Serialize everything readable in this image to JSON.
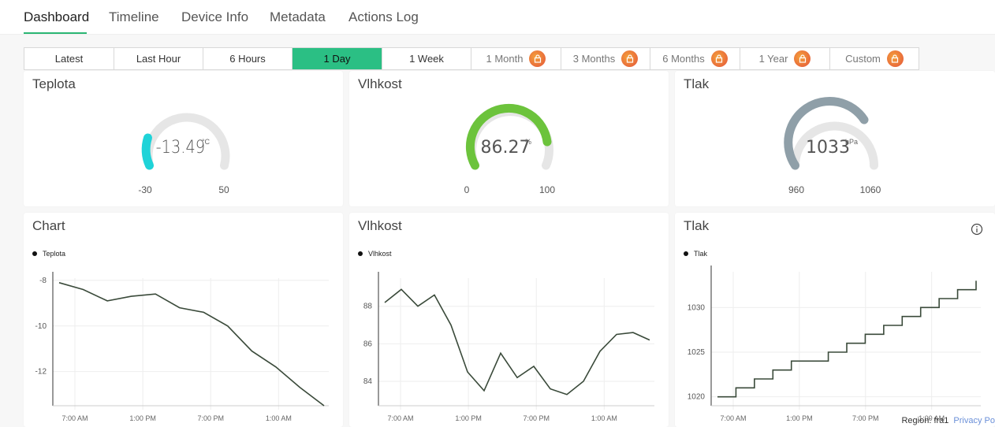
{
  "tabs": [
    {
      "label": "Dashboard",
      "active": true
    },
    {
      "label": "Timeline"
    },
    {
      "label": "Device Info"
    },
    {
      "label": "Metadata"
    },
    {
      "label": "Actions Log"
    }
  ],
  "ranges": [
    {
      "label": "Latest"
    },
    {
      "label": "Last Hour"
    },
    {
      "label": "6 Hours"
    },
    {
      "label": "1 Day",
      "active": true
    },
    {
      "label": "1 Week"
    },
    {
      "label": "1 Month",
      "locked": true
    },
    {
      "label": "3 Months",
      "locked": true
    },
    {
      "label": "6 Months",
      "locked": true
    },
    {
      "label": "1 Year",
      "locked": true
    },
    {
      "label": "Custom",
      "locked": true
    }
  ],
  "gauges": [
    {
      "title": "Teplota",
      "value": "-13.49",
      "unit": "°C",
      "min": "-30",
      "max": "50",
      "color": "#1fd3d8"
    },
    {
      "title": "Vlhkost",
      "value": "86.27",
      "unit": "%",
      "min": "0",
      "max": "100",
      "color": "#6cc33c"
    },
    {
      "title": "Tlak",
      "value": "1033",
      "unit": "hPa",
      "min": "960",
      "max": "1060",
      "color": "#8f9fa8"
    }
  ],
  "charts": [
    {
      "title": "Chart",
      "legend": "Teplota",
      "yticks": [
        "-8",
        "-10",
        "-12"
      ],
      "xticks": [
        "7:00 AM",
        "1:00 PM",
        "7:00 PM",
        "1:00 AM"
      ]
    },
    {
      "title": "Vlhkost",
      "legend": "Vlhkost",
      "yticks": [
        "88",
        "86",
        "84"
      ],
      "xticks": [
        "7:00 AM",
        "1:00 PM",
        "7:00 PM",
        "1:00 AM"
      ]
    },
    {
      "title": "Tlak",
      "legend": "Tlak",
      "yticks": [
        "1030",
        "1025",
        "1020"
      ],
      "xticks": [
        "7:00 AM",
        "1:00 PM",
        "7:00 PM",
        "1:00 AM"
      ]
    }
  ],
  "chart_data": [
    {
      "type": "line",
      "title": "Chart",
      "series": [
        {
          "name": "Teplota",
          "values": [
            -8.1,
            -8.4,
            -8.9,
            -8.7,
            -8.6,
            -9.2,
            -9.4,
            -10.0,
            -11.1,
            -11.8,
            -12.7,
            -13.5
          ]
        }
      ],
      "ylim": [
        -13.5,
        -7.9
      ]
    },
    {
      "type": "line",
      "title": "Vlhkost",
      "series": [
        {
          "name": "Vlhkost",
          "values": [
            88.2,
            88.9,
            88.0,
            88.6,
            87.0,
            84.5,
            83.5,
            85.5,
            84.2,
            84.8,
            83.6,
            83.3,
            84.0,
            85.6,
            86.5,
            86.6,
            86.2
          ]
        }
      ],
      "ylim": [
        82.7,
        89.5
      ]
    },
    {
      "type": "line",
      "title": "Tlak",
      "series": [
        {
          "name": "Tlak",
          "values": [
            1020,
            1021,
            1022,
            1023,
            1024,
            1024,
            1025,
            1026,
            1027,
            1028,
            1029,
            1030,
            1031,
            1032,
            1033
          ]
        }
      ],
      "ylim": [
        1019,
        1034
      ]
    }
  ],
  "footer": {
    "region": "Region: fra1",
    "privacy": "Privacy Po"
  },
  "icons": {
    "info": "info-icon",
    "lock": "lock-icon"
  }
}
